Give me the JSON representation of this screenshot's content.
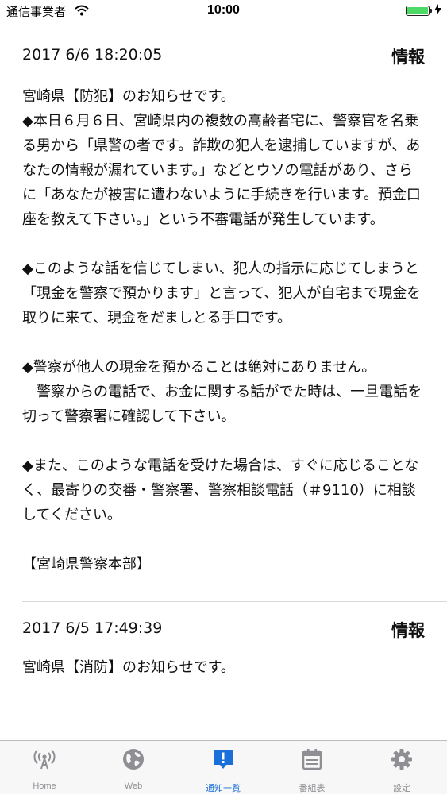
{
  "status_bar": {
    "carrier": "通信事業者",
    "time": "10:00"
  },
  "notices": [
    {
      "date": "2017 6/6 18:20:05",
      "tag": "情報",
      "body": "宮崎県【防犯】のお知らせです。\n◆本日６月６日、宮崎県内の複数の高齢者宅に、警察官を名乗る男から「県警の者です。詐欺の犯人を逮捕していますが、あなたの情報が漏れています。」などとウソの電話があり、さらに「あなたが被害に遭わないように手続きを行います。預金口座を教えて下さい。」という不審電話が発生しています。\n\n◆このような話を信じてしまい、犯人の指示に応じてしまうと「現金を警察で預かります」と言って、犯人が自宅まで現金を取りに来て、現金をだましとる手口です。\n\n◆警察が他人の現金を預かることは絶対にありません。\n　警察からの電話で、お金に関する話がでた時は、一旦電話を切って警察署に確認して下さい。\n\n◆また、このような電話を受けた場合は、すぐに応じることなく、最寄りの交番・警察署、警察相談電話（＃9110）に相談してください。\n\n【宮崎県警察本部】"
    },
    {
      "date": "2017 6/5 17:49:39",
      "tag": "情報",
      "body": "宮崎県【消防】のお知らせです。"
    }
  ],
  "tabbar": {
    "home": "Home",
    "web": "Web",
    "notices": "通知一覧",
    "schedule": "番組表",
    "settings": "設定",
    "active_tab": "notices",
    "active_color": "#1a6fd8",
    "inactive_color": "#8e8e93"
  }
}
